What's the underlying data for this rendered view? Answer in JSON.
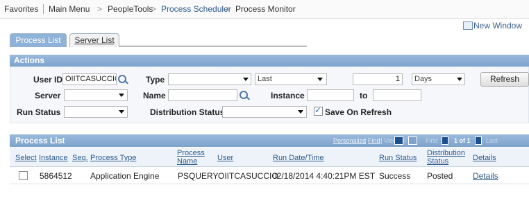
{
  "breadcrumb": {
    "items": [
      "Favorites",
      "Main Menu",
      "PeopleTools",
      "Process Scheduler",
      "Process Monitor"
    ],
    "separator": ">"
  },
  "header": {
    "new_window_label": "New Window"
  },
  "tabs": [
    {
      "label": "Process List",
      "active": true
    },
    {
      "label": "Server List",
      "active": false
    }
  ],
  "actions": {
    "title": "Actions",
    "user_id_label": "User ID",
    "user_id_value": "OIITCASUCCIO",
    "type_label": "Type",
    "type_value": "",
    "last_value": "Last",
    "last_count": "1",
    "units_value": "Days",
    "refresh_label": "Refresh",
    "server_label": "Server",
    "server_value": "",
    "name_label": "Name",
    "name_value": "",
    "instance_label": "Instance",
    "instance_from": "",
    "to_label": "to",
    "instance_to": "",
    "run_status_label": "Run Status",
    "run_status_value": "",
    "distribution_status_label": "Distribution Status",
    "distribution_status_value": "",
    "save_on_refresh_label": "Save On Refresh",
    "save_on_refresh_checked": true
  },
  "process_list": {
    "title": "Process List",
    "nav": {
      "personalize": "Personalize",
      "find": "Find",
      "view_all": "View All",
      "first": "First",
      "range": "1 of 1",
      "last": "Last"
    },
    "columns": [
      "Select",
      "Instance",
      "Seq.",
      "Process Type",
      "Process Name",
      "User",
      "Run Date/Time",
      "Run Status",
      "Distribution Status",
      "Details"
    ],
    "rows": [
      {
        "select": false,
        "instance": "5864512",
        "seq": "",
        "process_type": "Application Engine",
        "process_name": "PSQUERY",
        "user": "OIITCASUCCIO",
        "run_datetime": "02/18/2014  4:40:21PM EST",
        "run_status": "Success",
        "distribution_status": "Posted",
        "details": "Details"
      }
    ]
  },
  "colors": {
    "header_blue": "#8fb2d8",
    "link_blue": "#2d5b8c"
  }
}
